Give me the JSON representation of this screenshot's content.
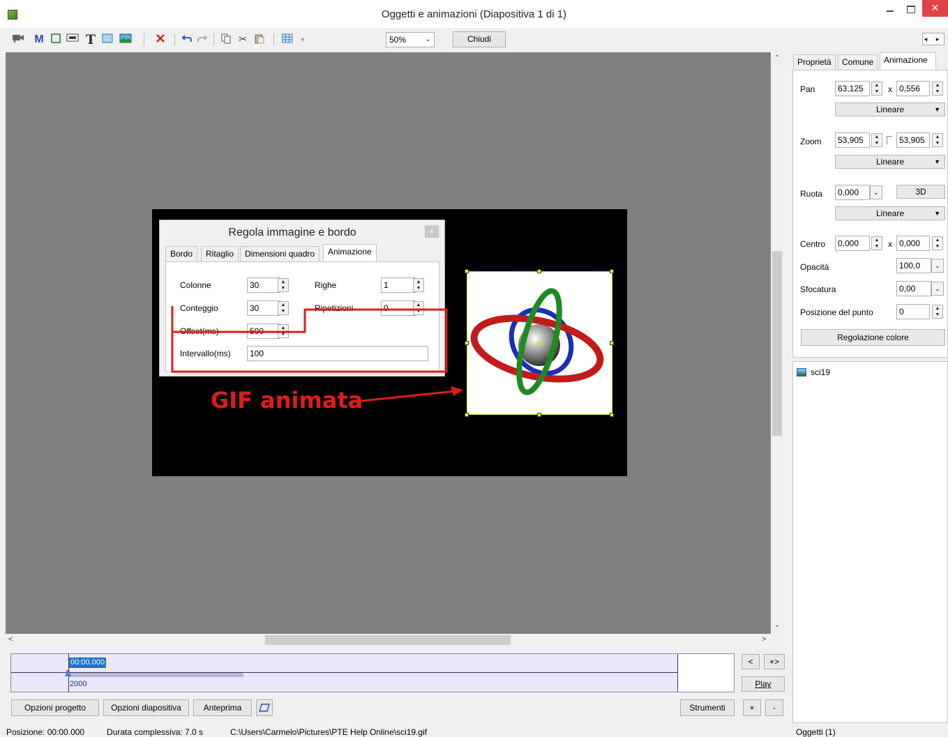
{
  "window": {
    "title": "Oggetti e animazioni  (Diapositiva 1 di 1)",
    "close_glyph": "✕"
  },
  "toolbar": {
    "zoom_value": "50%",
    "close_label": "Chiudi",
    "nav_glyph": "◂ ▸"
  },
  "dialog": {
    "title": "Regola immagine e bordo",
    "close_glyph": "x",
    "tabs": [
      {
        "label": "Bordo"
      },
      {
        "label": "Ritaglio"
      },
      {
        "label": "Dimensioni quadro"
      },
      {
        "label": "Animazione"
      }
    ],
    "fields": {
      "colonne_label": "Colonne",
      "colonne_value": "30",
      "righe_label": "Righe",
      "righe_value": "1",
      "conteggio_label": "Conteggio",
      "conteggio_value": "30",
      "ripetizioni_label": "Ripetizioni",
      "ripetizioni_value": "0",
      "offset_label": "Offset(ms)",
      "offset_value": "500",
      "intervallo_label": "Intervallo(ms)",
      "intervallo_value": "100"
    }
  },
  "annotation": {
    "label": "GIF animata",
    "color": "#e01b1b"
  },
  "timeline": {
    "time": "00:00.000",
    "count": "2000",
    "prev_label": "<",
    "next_label": "+>",
    "play_label": "Play",
    "plus_label": "+",
    "minus_label": "-"
  },
  "bottom": {
    "opzioni_progetto": "Opzioni progetto",
    "opzioni_diapositiva": "Opzioni diapositiva",
    "anteprima": "Anteprima",
    "strumenti": "Strumenti"
  },
  "status": {
    "posizione": "Posizione:  00:00.000",
    "durata": "Durata complessiva:  7.0 s",
    "path": "C:\\Users\\Carmelo\\Pictures\\PTE Help Online\\sci19.gif",
    "oggetti": "Oggetti (1)"
  },
  "right_panel": {
    "tabs": [
      {
        "label": "Proprietà"
      },
      {
        "label": "Comune"
      },
      {
        "label": "Animazione"
      }
    ],
    "pan_label": "Pan",
    "pan_x": "63,125",
    "pan_sep": "x",
    "pan_y": "0,556",
    "pan_interp": "Lineare",
    "zoom_label": "Zoom",
    "zoom_x": "53,905",
    "zoom_y": "53,905",
    "zoom_interp": "Lineare",
    "ruota_label": "Ruota",
    "ruota_value": "0,000",
    "btn_3d": "3D",
    "ruota_interp": "Lineare",
    "centro_label": "Centro",
    "centro_x": "0,000",
    "centro_sep": "x",
    "centro_y": "0,000",
    "opacita_label": "Opacità",
    "opacita_value": "100,0",
    "sfocatura_label": "Sfocatura",
    "sfocatura_value": "0,00",
    "posizione_punto_label": "Posizione del punto",
    "posizione_punto_value": "0",
    "regolazione_colore": "Regolazione colore"
  },
  "object_list": [
    {
      "name": "sci19"
    }
  ]
}
